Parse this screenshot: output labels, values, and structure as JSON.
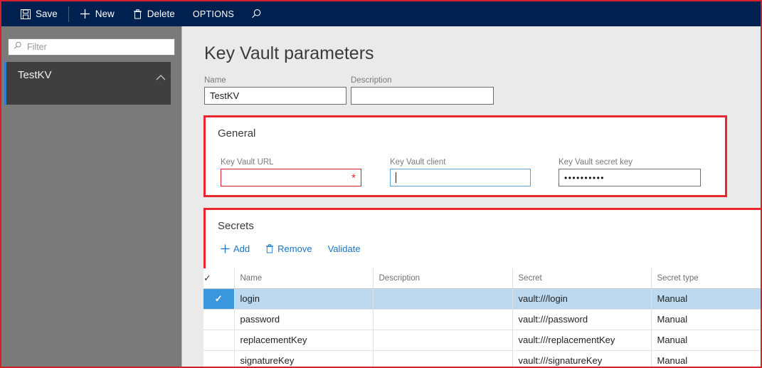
{
  "topbar": {
    "save_label": "Save",
    "new_label": "New",
    "delete_label": "Delete",
    "options_label": "OPTIONS",
    "search_icon": "search-icon",
    "background": "#002050"
  },
  "sidebar": {
    "filter_placeholder": "Filter",
    "filter_value": "",
    "filter_icon": "search-icon",
    "items": [
      {
        "label": "TestKV",
        "selected": true,
        "chevron": "chevron-up-icon"
      }
    ]
  },
  "main": {
    "title": "Key Vault parameters",
    "header_fields": [
      {
        "label": "Name",
        "value": "TestKV"
      },
      {
        "label": "Description",
        "value": ""
      }
    ],
    "general": {
      "title": "General",
      "highlight_color": "#e8262d",
      "fields": [
        {
          "label": "Key Vault URL",
          "value": "",
          "state": "required",
          "marker": "*"
        },
        {
          "label": "Key Vault client",
          "value": "",
          "state": "focused",
          "marker": ""
        },
        {
          "label": "Key Vault secret key",
          "value": "••••••••••",
          "state": "normal",
          "marker": ""
        }
      ]
    },
    "secrets": {
      "title": "Secrets",
      "highlight_color": "#e8262d",
      "toolbar": [
        {
          "label": "Add",
          "icon": "plus-icon"
        },
        {
          "label": "Remove",
          "icon": "trash-icon"
        },
        {
          "label": "Validate",
          "icon": "none"
        }
      ],
      "columns": [
        "",
        "Name",
        "Description",
        "Secret",
        "Secret type"
      ],
      "rows": [
        {
          "checked": true,
          "name": "login",
          "description": "",
          "secret": "vault:///login",
          "secret_type": "Manual",
          "dropdown": true
        },
        {
          "checked": false,
          "name": "password",
          "description": "",
          "secret": "vault:///password",
          "secret_type": "Manual",
          "dropdown": false
        },
        {
          "checked": false,
          "name": "replacementKey",
          "description": "",
          "secret": "vault:///replacementKey",
          "secret_type": "Manual",
          "dropdown": false
        },
        {
          "checked": false,
          "name": "signatureKey",
          "description": "",
          "secret": "vault:///signatureKey",
          "secret_type": "Manual",
          "dropdown": false
        }
      ]
    }
  }
}
